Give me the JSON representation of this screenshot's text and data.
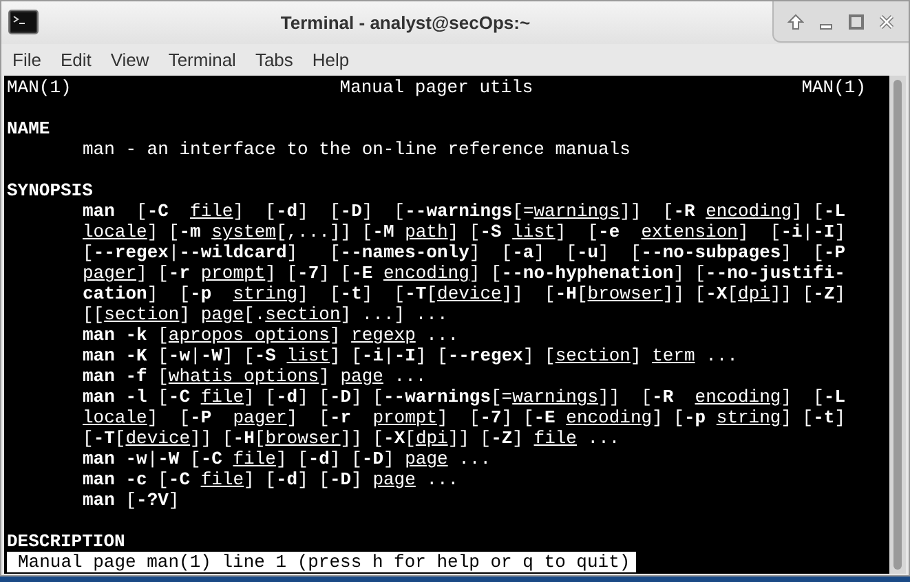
{
  "window": {
    "title": "Terminal - analyst@secOps:~"
  },
  "menu": [
    "File",
    "Edit",
    "View",
    "Terminal",
    "Tabs",
    "Help"
  ],
  "header": {
    "left": "MAN(1)",
    "center": "Manual pager utils",
    "right": "MAN(1)"
  },
  "sections": [
    {
      "heading": "NAME",
      "lines": [
        [
          {
            "kind": "plain",
            "text": "man - an interface to the on-line reference manuals"
          }
        ]
      ]
    },
    {
      "heading": "SYNOPSIS",
      "lines": [
        [
          {
            "kind": "bold",
            "text": "man"
          },
          {
            "kind": "plain",
            "text": "  ["
          },
          {
            "kind": "bold",
            "text": "-C  "
          },
          {
            "kind": "underline",
            "text": "file"
          },
          {
            "kind": "plain",
            "text": "]  ["
          },
          {
            "kind": "bold",
            "text": "-d"
          },
          {
            "kind": "plain",
            "text": "]  ["
          },
          {
            "kind": "bold",
            "text": "-D"
          },
          {
            "kind": "plain",
            "text": "]  ["
          },
          {
            "kind": "bold",
            "text": "--warnings"
          },
          {
            "kind": "plain",
            "text": "[="
          },
          {
            "kind": "underline",
            "text": "warnings"
          },
          {
            "kind": "plain",
            "text": "]]  ["
          },
          {
            "kind": "bold",
            "text": "-R "
          },
          {
            "kind": "underline",
            "text": "encoding"
          },
          {
            "kind": "plain",
            "text": "] ["
          },
          {
            "kind": "bold",
            "text": "-L"
          }
        ],
        [
          {
            "kind": "underline",
            "text": "locale"
          },
          {
            "kind": "plain",
            "text": "] ["
          },
          {
            "kind": "bold",
            "text": "-m "
          },
          {
            "kind": "underline",
            "text": "system"
          },
          {
            "kind": "plain",
            "text": "[,...]] ["
          },
          {
            "kind": "bold",
            "text": "-M "
          },
          {
            "kind": "underline",
            "text": "path"
          },
          {
            "kind": "plain",
            "text": "] ["
          },
          {
            "kind": "bold",
            "text": "-S "
          },
          {
            "kind": "underline",
            "text": "list"
          },
          {
            "kind": "plain",
            "text": "]  ["
          },
          {
            "kind": "bold",
            "text": "-e  "
          },
          {
            "kind": "underline",
            "text": "extension"
          },
          {
            "kind": "plain",
            "text": "]  ["
          },
          {
            "kind": "bold",
            "text": "-i"
          },
          {
            "kind": "plain",
            "text": "|"
          },
          {
            "kind": "bold",
            "text": "-I"
          },
          {
            "kind": "plain",
            "text": "]"
          }
        ],
        [
          {
            "kind": "plain",
            "text": "["
          },
          {
            "kind": "bold",
            "text": "--regex"
          },
          {
            "kind": "plain",
            "text": "|"
          },
          {
            "kind": "bold",
            "text": "--wildcard"
          },
          {
            "kind": "plain",
            "text": "]   ["
          },
          {
            "kind": "bold",
            "text": "--names-only"
          },
          {
            "kind": "plain",
            "text": "]  ["
          },
          {
            "kind": "bold",
            "text": "-a"
          },
          {
            "kind": "plain",
            "text": "]  ["
          },
          {
            "kind": "bold",
            "text": "-u"
          },
          {
            "kind": "plain",
            "text": "]  ["
          },
          {
            "kind": "bold",
            "text": "--no-subpages"
          },
          {
            "kind": "plain",
            "text": "]  ["
          },
          {
            "kind": "bold",
            "text": "-P"
          }
        ],
        [
          {
            "kind": "underline",
            "text": "pager"
          },
          {
            "kind": "plain",
            "text": "] ["
          },
          {
            "kind": "bold",
            "text": "-r "
          },
          {
            "kind": "underline",
            "text": "prompt"
          },
          {
            "kind": "plain",
            "text": "] ["
          },
          {
            "kind": "bold",
            "text": "-7"
          },
          {
            "kind": "plain",
            "text": "] ["
          },
          {
            "kind": "bold",
            "text": "-E "
          },
          {
            "kind": "underline",
            "text": "encoding"
          },
          {
            "kind": "plain",
            "text": "] ["
          },
          {
            "kind": "bold",
            "text": "--no-hyphenation"
          },
          {
            "kind": "plain",
            "text": "] ["
          },
          {
            "kind": "bold",
            "text": "--no-justifi-"
          }
        ],
        [
          {
            "kind": "bold",
            "text": "cation"
          },
          {
            "kind": "plain",
            "text": "]  ["
          },
          {
            "kind": "bold",
            "text": "-p  "
          },
          {
            "kind": "underline",
            "text": "string"
          },
          {
            "kind": "plain",
            "text": "]  ["
          },
          {
            "kind": "bold",
            "text": "-t"
          },
          {
            "kind": "plain",
            "text": "]  ["
          },
          {
            "kind": "bold",
            "text": "-T"
          },
          {
            "kind": "plain",
            "text": "["
          },
          {
            "kind": "underline",
            "text": "device"
          },
          {
            "kind": "plain",
            "text": "]]  ["
          },
          {
            "kind": "bold",
            "text": "-H"
          },
          {
            "kind": "plain",
            "text": "["
          },
          {
            "kind": "underline",
            "text": "browser"
          },
          {
            "kind": "plain",
            "text": "]] ["
          },
          {
            "kind": "bold",
            "text": "-X"
          },
          {
            "kind": "plain",
            "text": "["
          },
          {
            "kind": "underline",
            "text": "dpi"
          },
          {
            "kind": "plain",
            "text": "]] ["
          },
          {
            "kind": "bold",
            "text": "-Z"
          },
          {
            "kind": "plain",
            "text": "]"
          }
        ],
        [
          {
            "kind": "plain",
            "text": "[["
          },
          {
            "kind": "underline",
            "text": "section"
          },
          {
            "kind": "plain",
            "text": "] "
          },
          {
            "kind": "underline",
            "text": "page"
          },
          {
            "kind": "plain",
            "text": "[."
          },
          {
            "kind": "underline",
            "text": "section"
          },
          {
            "kind": "plain",
            "text": "] ...] ..."
          }
        ],
        [
          {
            "kind": "bold",
            "text": "man -k"
          },
          {
            "kind": "plain",
            "text": " ["
          },
          {
            "kind": "underline",
            "text": "apropos options"
          },
          {
            "kind": "plain",
            "text": "] "
          },
          {
            "kind": "underline",
            "text": "regexp"
          },
          {
            "kind": "plain",
            "text": " ..."
          }
        ],
        [
          {
            "kind": "bold",
            "text": "man -K"
          },
          {
            "kind": "plain",
            "text": " ["
          },
          {
            "kind": "bold",
            "text": "-w"
          },
          {
            "kind": "plain",
            "text": "|"
          },
          {
            "kind": "bold",
            "text": "-W"
          },
          {
            "kind": "plain",
            "text": "] ["
          },
          {
            "kind": "bold",
            "text": "-S "
          },
          {
            "kind": "underline",
            "text": "list"
          },
          {
            "kind": "plain",
            "text": "] ["
          },
          {
            "kind": "bold",
            "text": "-i"
          },
          {
            "kind": "plain",
            "text": "|"
          },
          {
            "kind": "bold",
            "text": "-I"
          },
          {
            "kind": "plain",
            "text": "] ["
          },
          {
            "kind": "bold",
            "text": "--regex"
          },
          {
            "kind": "plain",
            "text": "] ["
          },
          {
            "kind": "underline",
            "text": "section"
          },
          {
            "kind": "plain",
            "text": "] "
          },
          {
            "kind": "underline",
            "text": "term"
          },
          {
            "kind": "plain",
            "text": " ..."
          }
        ],
        [
          {
            "kind": "bold",
            "text": "man -f"
          },
          {
            "kind": "plain",
            "text": " ["
          },
          {
            "kind": "underline",
            "text": "whatis options"
          },
          {
            "kind": "plain",
            "text": "] "
          },
          {
            "kind": "underline",
            "text": "page"
          },
          {
            "kind": "plain",
            "text": " ..."
          }
        ],
        [
          {
            "kind": "bold",
            "text": "man -l"
          },
          {
            "kind": "plain",
            "text": " ["
          },
          {
            "kind": "bold",
            "text": "-C "
          },
          {
            "kind": "underline",
            "text": "file"
          },
          {
            "kind": "plain",
            "text": "] ["
          },
          {
            "kind": "bold",
            "text": "-d"
          },
          {
            "kind": "plain",
            "text": "] ["
          },
          {
            "kind": "bold",
            "text": "-D"
          },
          {
            "kind": "plain",
            "text": "] ["
          },
          {
            "kind": "bold",
            "text": "--warnings"
          },
          {
            "kind": "plain",
            "text": "[="
          },
          {
            "kind": "underline",
            "text": "warnings"
          },
          {
            "kind": "plain",
            "text": "]]  ["
          },
          {
            "kind": "bold",
            "text": "-R  "
          },
          {
            "kind": "underline",
            "text": "encoding"
          },
          {
            "kind": "plain",
            "text": "]  ["
          },
          {
            "kind": "bold",
            "text": "-L"
          }
        ],
        [
          {
            "kind": "underline",
            "text": "locale"
          },
          {
            "kind": "plain",
            "text": "]  ["
          },
          {
            "kind": "bold",
            "text": "-P  "
          },
          {
            "kind": "underline",
            "text": "pager"
          },
          {
            "kind": "plain",
            "text": "]  ["
          },
          {
            "kind": "bold",
            "text": "-r  "
          },
          {
            "kind": "underline",
            "text": "prompt"
          },
          {
            "kind": "plain",
            "text": "]  ["
          },
          {
            "kind": "bold",
            "text": "-7"
          },
          {
            "kind": "plain",
            "text": "] ["
          },
          {
            "kind": "bold",
            "text": "-E "
          },
          {
            "kind": "underline",
            "text": "encoding"
          },
          {
            "kind": "plain",
            "text": "] ["
          },
          {
            "kind": "bold",
            "text": "-p "
          },
          {
            "kind": "underline",
            "text": "string"
          },
          {
            "kind": "plain",
            "text": "] ["
          },
          {
            "kind": "bold",
            "text": "-t"
          },
          {
            "kind": "plain",
            "text": "]"
          }
        ],
        [
          {
            "kind": "plain",
            "text": "["
          },
          {
            "kind": "bold",
            "text": "-T"
          },
          {
            "kind": "plain",
            "text": "["
          },
          {
            "kind": "underline",
            "text": "device"
          },
          {
            "kind": "plain",
            "text": "]] ["
          },
          {
            "kind": "bold",
            "text": "-H"
          },
          {
            "kind": "plain",
            "text": "["
          },
          {
            "kind": "underline",
            "text": "browser"
          },
          {
            "kind": "plain",
            "text": "]] ["
          },
          {
            "kind": "bold",
            "text": "-X"
          },
          {
            "kind": "plain",
            "text": "["
          },
          {
            "kind": "underline",
            "text": "dpi"
          },
          {
            "kind": "plain",
            "text": "]] ["
          },
          {
            "kind": "bold",
            "text": "-Z"
          },
          {
            "kind": "plain",
            "text": "] "
          },
          {
            "kind": "underline",
            "text": "file"
          },
          {
            "kind": "plain",
            "text": " ..."
          }
        ],
        [
          {
            "kind": "bold",
            "text": "man -w"
          },
          {
            "kind": "plain",
            "text": "|"
          },
          {
            "kind": "bold",
            "text": "-W"
          },
          {
            "kind": "plain",
            "text": " ["
          },
          {
            "kind": "bold",
            "text": "-C "
          },
          {
            "kind": "underline",
            "text": "file"
          },
          {
            "kind": "plain",
            "text": "] ["
          },
          {
            "kind": "bold",
            "text": "-d"
          },
          {
            "kind": "plain",
            "text": "] ["
          },
          {
            "kind": "bold",
            "text": "-D"
          },
          {
            "kind": "plain",
            "text": "] "
          },
          {
            "kind": "underline",
            "text": "page"
          },
          {
            "kind": "plain",
            "text": " ..."
          }
        ],
        [
          {
            "kind": "bold",
            "text": "man -c"
          },
          {
            "kind": "plain",
            "text": " ["
          },
          {
            "kind": "bold",
            "text": "-C "
          },
          {
            "kind": "underline",
            "text": "file"
          },
          {
            "kind": "plain",
            "text": "] ["
          },
          {
            "kind": "bold",
            "text": "-d"
          },
          {
            "kind": "plain",
            "text": "] ["
          },
          {
            "kind": "bold",
            "text": "-D"
          },
          {
            "kind": "plain",
            "text": "] "
          },
          {
            "kind": "underline",
            "text": "page"
          },
          {
            "kind": "plain",
            "text": " ..."
          }
        ],
        [
          {
            "kind": "bold",
            "text": "man"
          },
          {
            "kind": "plain",
            "text": " ["
          },
          {
            "kind": "bold",
            "text": "-?V"
          },
          {
            "kind": "plain",
            "text": "]"
          }
        ]
      ]
    },
    {
      "heading": "DESCRIPTION"
    }
  ],
  "status": "Manual page man(1) line 1 (press h for help or q to quit)"
}
